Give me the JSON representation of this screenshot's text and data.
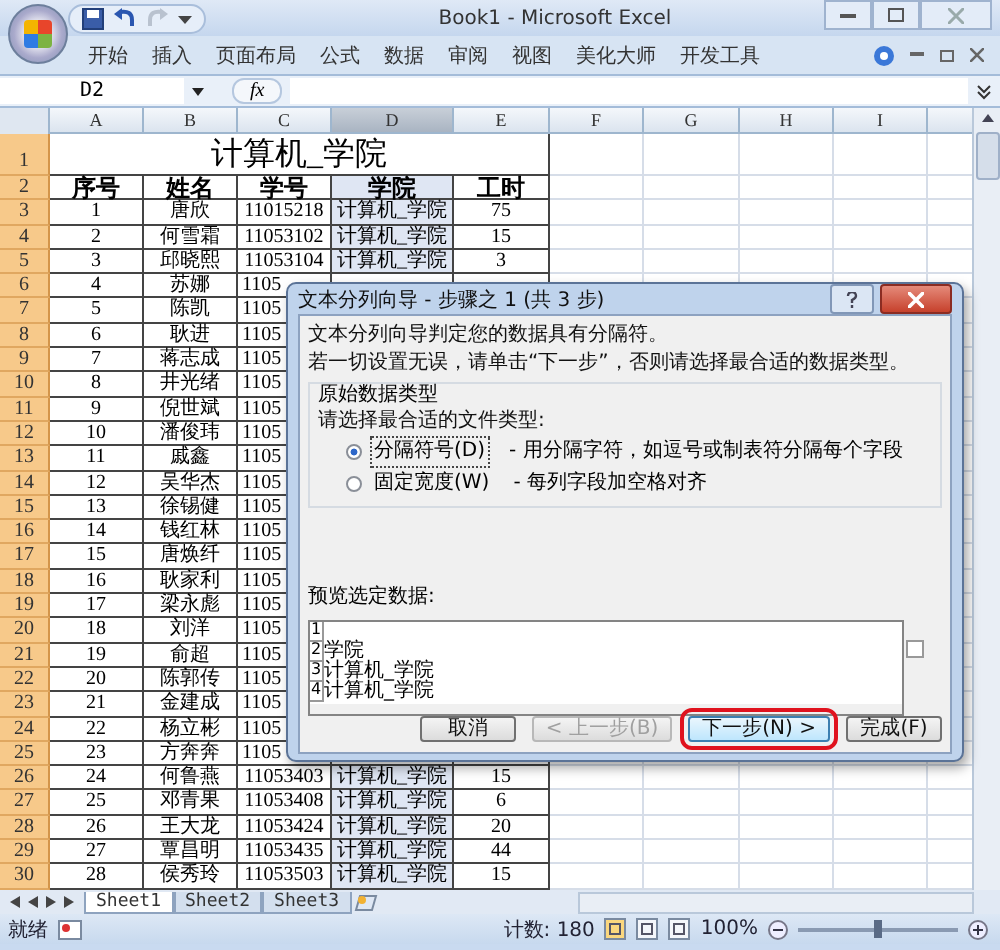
{
  "window": {
    "title": "Book1 - Microsoft Excel"
  },
  "ribbon_tabs": [
    "开始",
    "插入",
    "页面布局",
    "公式",
    "数据",
    "审阅",
    "视图",
    "美化大师",
    "开发工具"
  ],
  "name_box": "D2",
  "function_label": "fx",
  "columns": [
    {
      "label": "A",
      "selected": false
    },
    {
      "label": "B",
      "selected": false
    },
    {
      "label": "C",
      "selected": false
    },
    {
      "label": "D",
      "selected": true
    },
    {
      "label": "E",
      "selected": false
    },
    {
      "label": "F",
      "selected": false
    },
    {
      "label": "G",
      "selected": false
    },
    {
      "label": "H",
      "selected": false
    },
    {
      "label": "I",
      "selected": false
    }
  ],
  "title_row": {
    "row": "1",
    "text": "计算机_学院"
  },
  "rows": [
    {
      "row": "2",
      "cells": [
        "序号",
        "姓名",
        "学号",
        "学院",
        "工时"
      ]
    },
    {
      "row": "3",
      "cells": [
        "1",
        "唐欣",
        "11015218",
        "计算机_学院",
        "75"
      ]
    },
    {
      "row": "4",
      "cells": [
        "2",
        "何雪霜",
        "11053102",
        "计算机_学院",
        "15"
      ]
    },
    {
      "row": "5",
      "cells": [
        "3",
        "邱晓熙",
        "11053104",
        "计算机_学院",
        "3"
      ]
    },
    {
      "row": "6",
      "cells": [
        "4",
        "苏娜",
        "1105"
      ]
    },
    {
      "row": "7",
      "cells": [
        "5",
        "陈凯",
        "1105"
      ]
    },
    {
      "row": "8",
      "cells": [
        "6",
        "耿进",
        "1105"
      ]
    },
    {
      "row": "9",
      "cells": [
        "7",
        "蒋志成",
        "1105"
      ]
    },
    {
      "row": "10",
      "cells": [
        "8",
        "井光绪",
        "1105"
      ]
    },
    {
      "row": "11",
      "cells": [
        "9",
        "倪世斌",
        "1105"
      ]
    },
    {
      "row": "12",
      "cells": [
        "10",
        "潘俊玮",
        "1105"
      ]
    },
    {
      "row": "13",
      "cells": [
        "11",
        "戚鑫",
        "1105"
      ]
    },
    {
      "row": "14",
      "cells": [
        "12",
        "吴华杰",
        "1105"
      ]
    },
    {
      "row": "15",
      "cells": [
        "13",
        "徐锡健",
        "1105"
      ]
    },
    {
      "row": "16",
      "cells": [
        "14",
        "钱红林",
        "1105"
      ]
    },
    {
      "row": "17",
      "cells": [
        "15",
        "唐焕纤",
        "1105"
      ]
    },
    {
      "row": "18",
      "cells": [
        "16",
        "耿家利",
        "1105"
      ]
    },
    {
      "row": "19",
      "cells": [
        "17",
        "梁永彪",
        "1105"
      ]
    },
    {
      "row": "20",
      "cells": [
        "18",
        "刘洋",
        "1105"
      ]
    },
    {
      "row": "21",
      "cells": [
        "19",
        "俞超",
        "1105"
      ]
    },
    {
      "row": "22",
      "cells": [
        "20",
        "陈郭传",
        "1105"
      ]
    },
    {
      "row": "23",
      "cells": [
        "21",
        "金建成",
        "1105"
      ]
    },
    {
      "row": "24",
      "cells": [
        "22",
        "杨立彬",
        "1105"
      ]
    },
    {
      "row": "25",
      "cells": [
        "23",
        "方奔奔",
        "1105"
      ]
    },
    {
      "row": "26",
      "cells": [
        "24",
        "何鲁燕",
        "11053403",
        "计算机_学院",
        "15"
      ]
    },
    {
      "row": "27",
      "cells": [
        "25",
        "邓青果",
        "11053408",
        "计算机_学院",
        "6"
      ]
    },
    {
      "row": "28",
      "cells": [
        "26",
        "王大龙",
        "11053424",
        "计算机_学院",
        "20"
      ]
    },
    {
      "row": "29",
      "cells": [
        "27",
        "覃昌明",
        "11053435",
        "计算机_学院",
        "44"
      ]
    },
    {
      "row": "30",
      "cells": [
        "28",
        "侯秀玲",
        "11053503",
        "计算机_学院",
        "15"
      ]
    }
  ],
  "sheet_tabs": [
    {
      "label": "Sheet1",
      "selected": true
    },
    {
      "label": "Sheet2",
      "selected": false
    },
    {
      "label": "Sheet3",
      "selected": false
    }
  ],
  "status_bar": {
    "mode": "就绪",
    "count": "计数: 180",
    "zoom": "100%",
    "zoom_slider": {
      "level": 0.5
    }
  },
  "dialog": {
    "title": "文本分列向导 - 步骤之 1 (共 3 步)",
    "messages": [
      "文本分列向导判定您的数据具有分隔符。",
      "若一切设置无误，请单击“下一步”，否则请选择最合适的数据类型。"
    ],
    "group_title": "原始数据类型",
    "prompt": "请选择最合适的文件类型:",
    "options": [
      {
        "label": "分隔符号(D)",
        "description": "- 用分隔字符，如逗号或制表符分隔每个字段",
        "selected": true
      },
      {
        "label": "固定宽度(W)",
        "description": "- 每列字段加空格对齐",
        "selected": false
      }
    ],
    "preview_label": "预览选定数据:",
    "preview": [
      {
        "line": "1"
      },
      {
        "line": "2",
        "text": "学院"
      },
      {
        "line": "3",
        "text": "计算机_学院"
      },
      {
        "line": "4",
        "text": "计算机_学院"
      }
    ],
    "buttons": [
      {
        "label": "取消",
        "disabled": false,
        "highlighted": false
      },
      {
        "label": "< 上一步(B)",
        "disabled": true,
        "highlighted": false
      },
      {
        "label": "下一步(N) >",
        "disabled": false,
        "highlighted": true
      },
      {
        "label": "完成(F)",
        "disabled": false,
        "highlighted": false
      }
    ]
  }
}
